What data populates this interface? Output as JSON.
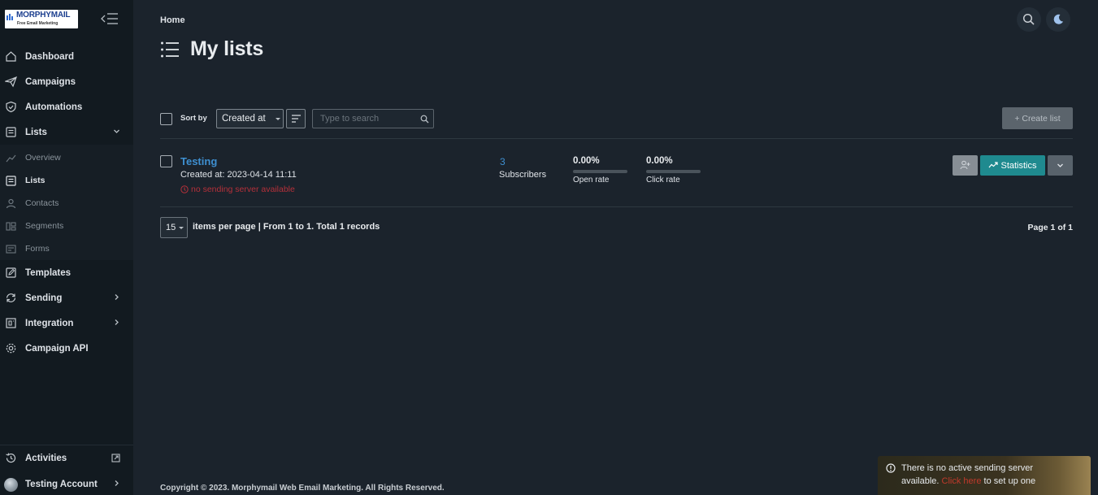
{
  "brand": {
    "name": "MORPHYMAIL",
    "tagline": "Free Email Marketing"
  },
  "sidebar": {
    "items": [
      {
        "label": "Dashboard",
        "icon": "home-icon"
      },
      {
        "label": "Campaigns",
        "icon": "paper-plane-icon"
      },
      {
        "label": "Automations",
        "icon": "shield-icon"
      },
      {
        "label": "Lists",
        "icon": "list-icon",
        "expanded": true
      }
    ],
    "subitems": [
      {
        "label": "Overview",
        "icon": "chart-icon"
      },
      {
        "label": "Lists",
        "icon": "list-icon",
        "active": true
      },
      {
        "label": "Contacts",
        "icon": "user-icon"
      },
      {
        "label": "Segments",
        "icon": "segment-icon"
      },
      {
        "label": "Forms",
        "icon": "form-icon"
      }
    ],
    "items_after": [
      {
        "label": "Templates",
        "icon": "pencil-icon"
      },
      {
        "label": "Sending",
        "icon": "sync-icon"
      },
      {
        "label": "Integration",
        "icon": "integration-icon"
      },
      {
        "label": "Campaign API",
        "icon": "gear-icon"
      }
    ],
    "bottom": {
      "activities": "Activities",
      "account": "Testing Account"
    }
  },
  "header": {
    "breadcrumb": "Home",
    "title": "My lists"
  },
  "toolbar": {
    "sort_label": "Sort by",
    "sort_value": "Created at",
    "search_placeholder": "Type to search",
    "create_label": "+ Create list"
  },
  "lists": [
    {
      "name": "Testing",
      "created": "Created at: 2023-04-14 11:11",
      "warning": "no sending server available",
      "subscribers_count": "3",
      "subscribers_label": "Subscribers",
      "open_rate": "0.00%",
      "open_rate_value": 0,
      "open_label": "Open rate",
      "click_rate": "0.00%",
      "click_rate_value": 0,
      "click_label": "Click rate",
      "statistics_label": "Statistics"
    }
  ],
  "pagination": {
    "per_page": "15",
    "per_page_text": "items per page",
    "range_text": "| From 1 to 1. Total 1 records",
    "page_info": "Page 1 of 1"
  },
  "footer": {
    "copyright": "Copyright © 2023. Morphymail Web Email Marketing. All Rights Reserved."
  },
  "toast": {
    "line1": "There is no active sending server",
    "line2_prefix": "available.",
    "link": "Click here",
    "line2_suffix": "to set up one"
  },
  "colors": {
    "accent_link": "#3e8fd0",
    "statistics_button": "#1f8a8f",
    "warning": "#b5303a",
    "sidebar_bg": "#121a20",
    "main_bg": "#1b232c"
  }
}
